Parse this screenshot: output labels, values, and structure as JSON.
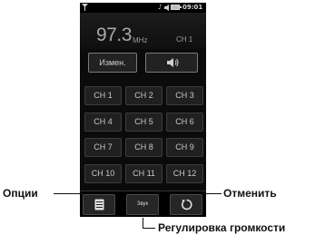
{
  "status_bar": {
    "signal_icon": "signal-antenna-icon",
    "music_icon_glyph": "♪",
    "time": "09:01"
  },
  "radio": {
    "frequency": "97.3",
    "unit": "MHz",
    "channel": "CH 1"
  },
  "actions": {
    "edit_label": "Измен.",
    "volume_icon": "speaker-icon"
  },
  "channels": [
    "CH 1",
    "CH 2",
    "CH 3",
    "CH 4",
    "CH 5",
    "CH 6",
    "CH 7",
    "CH 8",
    "CH 9",
    "CH 10",
    "CH 11",
    "CH 12"
  ],
  "bottom_bar": {
    "options_icon": "list-icon",
    "sound_label": "Звук",
    "cancel_icon": "undo-icon"
  },
  "callouts": {
    "options": "Опции",
    "cancel": "Отменить",
    "volume_adjust": "Регулировка громкости"
  }
}
